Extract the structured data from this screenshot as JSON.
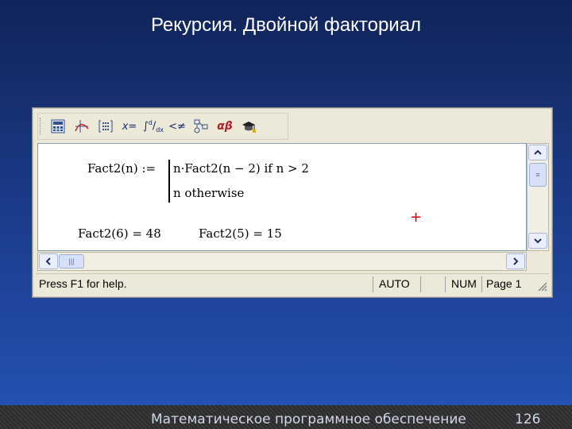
{
  "slide": {
    "title": "Рекурсия. Двойной факториал",
    "footer_text": "Математическое программное обеспечение",
    "page_number": "126"
  },
  "toolbar": {
    "buttons": [
      {
        "name": "calculator-icon"
      },
      {
        "name": "graph-icon"
      },
      {
        "name": "matrix-icon"
      },
      {
        "name": "evaluation-icon",
        "glyph": "x="
      },
      {
        "name": "calculus-icon",
        "glyph": "∫d/dx"
      },
      {
        "name": "boolean-icon",
        "glyph": "<≠"
      },
      {
        "name": "programming-icon"
      },
      {
        "name": "greek-icon",
        "glyph": "αβ"
      },
      {
        "name": "symbolic-icon"
      }
    ]
  },
  "worksheet": {
    "definition_lhs": "Fact2(n) :=",
    "branch1": "n·Fact2(n − 2)   if  n > 2",
    "branch2": "n   otherwise",
    "result1": "Fact2(6) = 48",
    "result2": "Fact2(5) = 15",
    "cursor": "+"
  },
  "statusbar": {
    "help": "Press F1 for help.",
    "mode": "AUTO",
    "num": "NUM",
    "page": "Page 1"
  }
}
